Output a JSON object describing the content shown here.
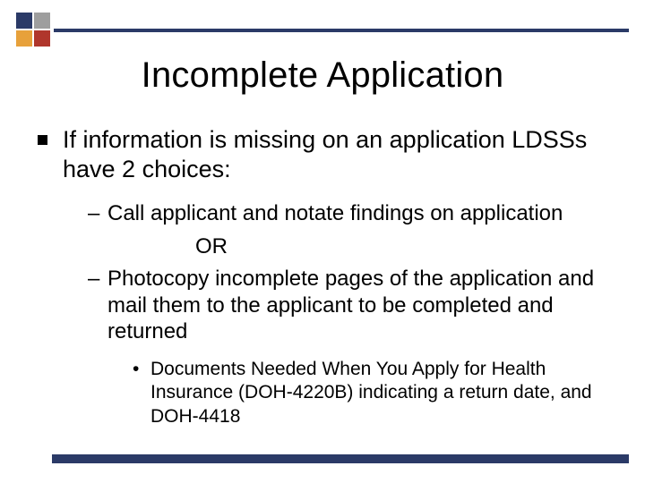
{
  "colors": {
    "navy": "#2b3a67",
    "gray": "#9e9e9e",
    "amber": "#e7a13b",
    "brick": "#b0362c"
  },
  "title": "Incomplete Application",
  "bullet_main": "If information is missing on an application LDSSs have 2 choices:",
  "sub1": "Call applicant and notate findings on application",
  "or_text": "OR",
  "sub2": "Photocopy incomplete pages of the application and mail them to the applicant to be completed and returned",
  "sub2_detail": "Documents Needed When You Apply for Health Insurance (DOH-4220B) indicating a return date, and DOH-4418"
}
